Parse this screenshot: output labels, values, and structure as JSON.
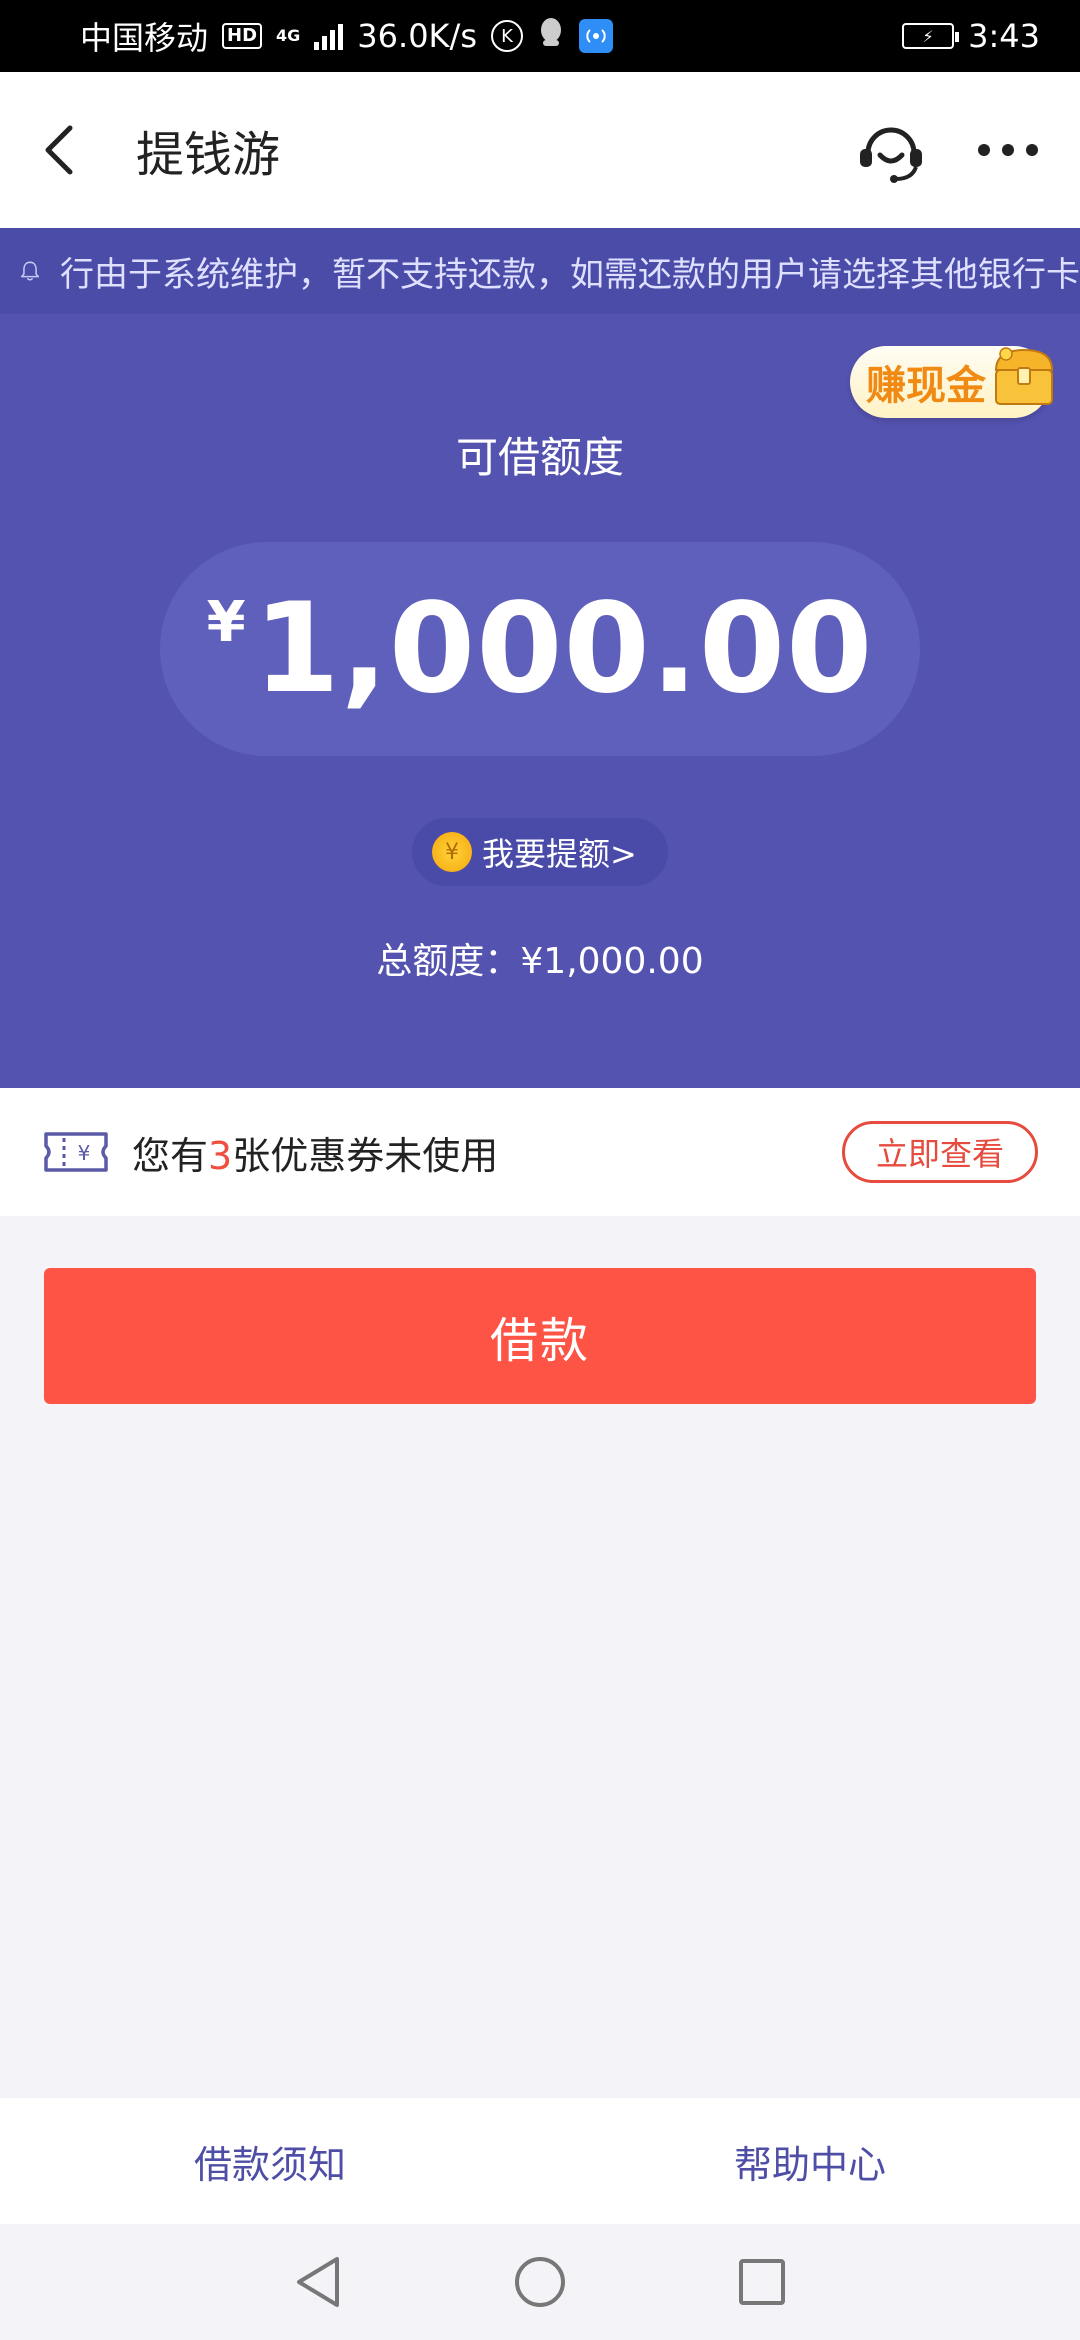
{
  "status_bar": {
    "carrier": "中国移动",
    "hd_badge": "HD",
    "network": "4G",
    "speed": "36.0K/s",
    "time": "3:43"
  },
  "header": {
    "title": "提钱游"
  },
  "notice": {
    "text": "行由于系统维护，暂不支持还款，如需还款的用户请选择其他银行卡"
  },
  "hero": {
    "earn_badge": "赚现金",
    "credit_label": "可借额度",
    "currency_symbol": "¥",
    "available_amount": "1,000.00",
    "raise_limit": "我要提额>",
    "total_line": "总额度：¥1,000.00"
  },
  "coupon": {
    "prefix": "您有",
    "count": "3",
    "suffix": "张优惠券未使用",
    "view_button": "立即查看"
  },
  "borrow_button": "借款",
  "footer": {
    "loan_notice": "借款须知",
    "help_center": "帮助中心"
  },
  "colors": {
    "primary_purple": "#5453b0",
    "notice_bg": "#4b4ca8",
    "accent_red": "#fd5446",
    "link_purple": "#4f4ea6"
  }
}
